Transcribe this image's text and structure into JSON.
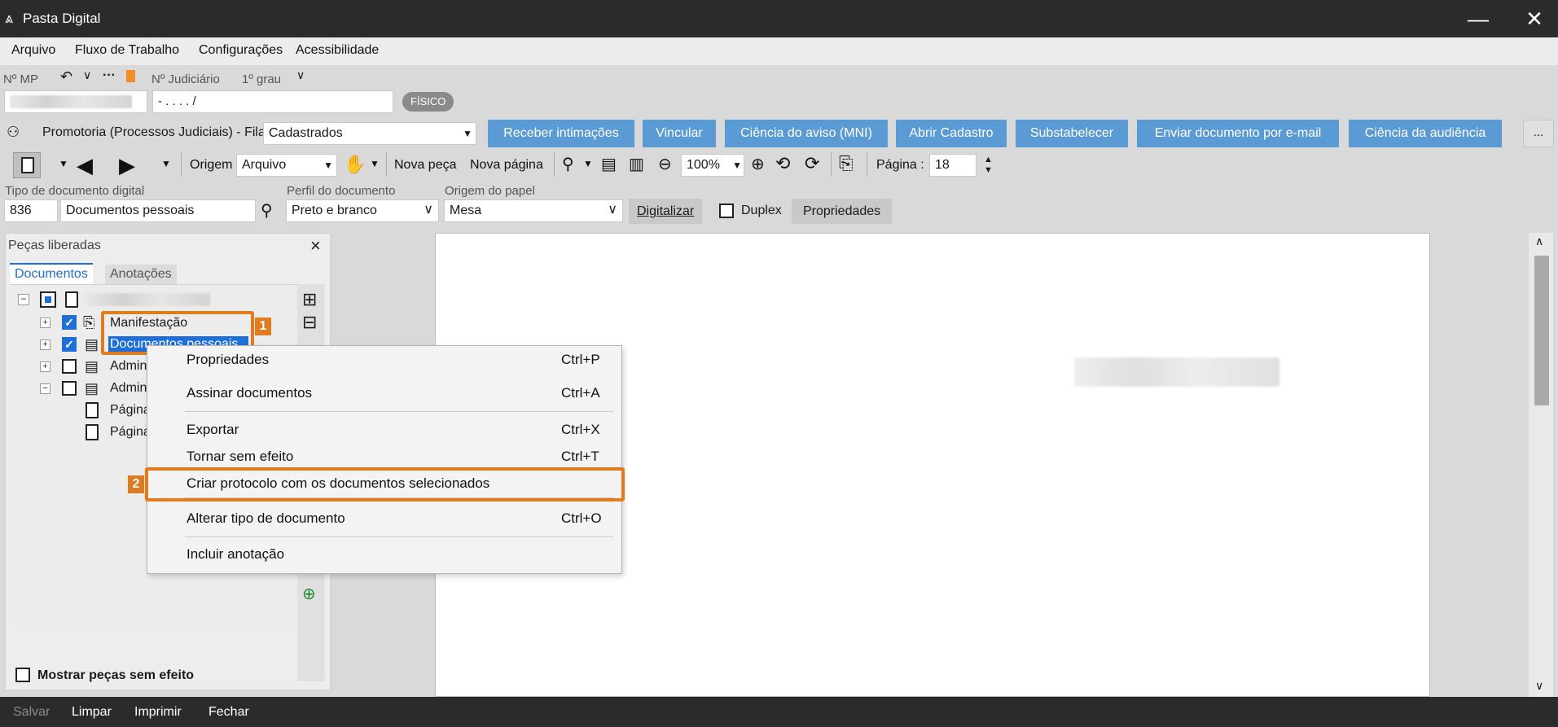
{
  "window": {
    "title": "Pasta Digital",
    "minimize": "—",
    "close": "✕"
  },
  "menu": [
    "Arquivo",
    "Fluxo de Trabalho",
    "Configurações",
    "Acessibilidade"
  ],
  "header": {
    "mp_label": "Nº MP",
    "judiciario_label": "Nº Judiciário",
    "grau": "1º grau",
    "judiciario_value": "- .   . . .   /",
    "fisico_badge": "FÍSICO"
  },
  "queue": {
    "label": "Promotoria (Processos Judiciais) - Fila",
    "value": "Cadastrados"
  },
  "actions": [
    "Receber intimações",
    "Vincular",
    "Ciência do aviso (MNI)",
    "Abrir Cadastro",
    "Substabelecer",
    "Enviar documento por e-mail",
    "Ciência da audiência",
    "..."
  ],
  "toolbar": {
    "origem_label": "Origem",
    "origem_value": "Arquivo",
    "nova_peca": "Nova peça",
    "nova_pagina": "Nova página",
    "zoom": "100%",
    "pagina_label": "Página :",
    "pagina_value": "18"
  },
  "docform": {
    "tipo_label": "Tipo de documento digital",
    "tipo_code": "836",
    "tipo_name": "Documentos pessoais",
    "perfil_label": "Perfil do documento",
    "perfil_value": "Preto e branco",
    "origem_papel_label": "Origem do papel",
    "origem_papel_value": "Mesa",
    "digitalizar": "Digitalizar",
    "duplex": "Duplex",
    "propriedades": "Propriedades"
  },
  "leftpanel": {
    "title": "Peças liberadas",
    "close": "×",
    "tabs": [
      "Documentos",
      "Anotações"
    ],
    "tree": [
      {
        "label": "Manifestação",
        "checked": true
      },
      {
        "label": "Documentos pessoais",
        "checked": true
      },
      {
        "label": "Admin",
        "checked": false
      },
      {
        "label": "Admin",
        "checked": false
      },
      {
        "label": "Página",
        "checked": false
      },
      {
        "label": "Página",
        "checked": false
      }
    ],
    "show_without_effect": "Mostrar peças sem efeito"
  },
  "context_menu": {
    "items": [
      {
        "label": "Propriedades",
        "shortcut": "Ctrl+P"
      },
      {
        "label": "Assinar documentos",
        "shortcut": "Ctrl+A"
      },
      {
        "label": "Exportar",
        "shortcut": "Ctrl+X"
      },
      {
        "label": "Tornar sem efeito",
        "shortcut": "Ctrl+T"
      },
      {
        "label": "Criar protocolo com os documentos selecionados",
        "shortcut": ""
      },
      {
        "label": "Alterar tipo de documento",
        "shortcut": "Ctrl+O"
      },
      {
        "label": "Incluir anotação",
        "shortcut": ""
      }
    ]
  },
  "callouts": [
    "1",
    "2"
  ],
  "statusbar": [
    "Salvar",
    "Limpar",
    "Imprimir",
    "Fechar"
  ],
  "colors": {
    "titlebar": "#2b2b2b",
    "action_button": "#5b9bd5",
    "callout": "#e07b1f",
    "selected": "#1e6fd9"
  }
}
